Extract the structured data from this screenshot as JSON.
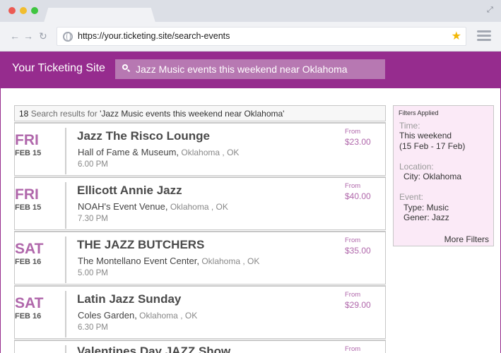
{
  "browser": {
    "url": "https://your.ticketing.site/search-events",
    "dot_colors": [
      "#ec5a53",
      "#f1bd2f",
      "#3fc540"
    ]
  },
  "site": {
    "title": "Your Ticketing Site",
    "search_value": "Jazz Music events this weekend near Oklahoma"
  },
  "results": {
    "count": "18",
    "prefix": " Search results for ",
    "query": "'Jazz Music events this weekend near Oklahoma'",
    "items": [
      {
        "weekday": "FRI",
        "date": "FEB 15",
        "title": "Jazz The Risco Lounge",
        "venue": "Hall of Fame & Museum,",
        "city": " Oklahoma , OK",
        "time": "6.00 PM",
        "from": "From",
        "price": "$23.00"
      },
      {
        "weekday": "FRI",
        "date": "FEB 15",
        "title": "Ellicott Annie Jazz",
        "venue": "NOAH's Event Venue,",
        "city": " Oklahoma , OK",
        "time": "7.30 PM",
        "from": "From",
        "price": "$40.00"
      },
      {
        "weekday": "SAT",
        "date": "FEB 16",
        "title": "THE JAZZ BUTCHERS",
        "venue": "The Montellano Event Center,",
        "city": " Oklahoma , OK",
        "time": "5.00 PM",
        "from": "From",
        "price": "$35.00"
      },
      {
        "weekday": "SAT",
        "date": "FEB 16",
        "title": "Latin Jazz Sunday",
        "venue": "Coles Garden,",
        "city": " Oklahoma , OK",
        "time": "6.30 PM",
        "from": "From",
        "price": "$29.00"
      },
      {
        "weekday": "",
        "date": "",
        "title": "Valentines Day JAZZ Show",
        "venue": "",
        "city": "",
        "time": "",
        "from": "From",
        "price": ""
      }
    ]
  },
  "filters": {
    "title": "Filters Applied",
    "time_label": "Time:",
    "time_value": "This weekend",
    "time_range": "(15 Feb - 17 Feb)",
    "location_label": "Location:",
    "location_value": "City: Oklahoma",
    "event_label": "Event:",
    "event_type": "Type:  Music",
    "event_genre": "Gener: Jazz",
    "more": "More Filters"
  }
}
